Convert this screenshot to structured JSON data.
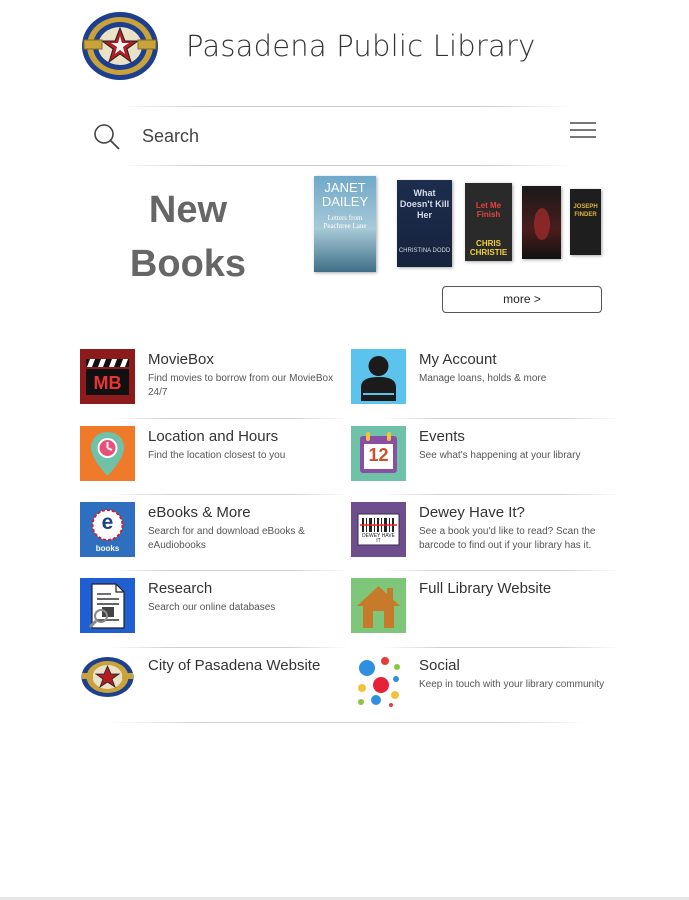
{
  "header": {
    "title": "Pasadena Public Library",
    "seal_icon": "city-seal-icon"
  },
  "search": {
    "placeholder": "Search",
    "value": ""
  },
  "new_books": {
    "heading_line1": "New",
    "heading_line2": "Books",
    "more_label": "more >",
    "covers": [
      {
        "author": "JANET DAILEY",
        "title": "Letters from Peachtree Lane"
      },
      {
        "title": "What Doesn't Kill Her",
        "author": "CHRISTINA DODD"
      },
      {
        "title": "Let Me Finish",
        "author": "CHRIS CHRISTIE"
      },
      {
        "title": ""
      },
      {
        "author": "JOSEPH FINDER"
      }
    ]
  },
  "tiles": [
    {
      "title": "MovieBox",
      "desc": "Find movies to borrow from our MovieBox 24/7",
      "icon": "moviebox-icon",
      "icon_text": "MB"
    },
    {
      "title": "My Account",
      "desc": "Manage loans, holds & more",
      "icon": "account-icon"
    },
    {
      "title": "Location and Hours",
      "desc": "Find the location closest to you",
      "icon": "location-clock-icon"
    },
    {
      "title": "Events",
      "desc": "See what's happening at your library",
      "icon": "calendar-icon",
      "icon_text": "12"
    },
    {
      "title": "eBooks & More",
      "desc": "Search for and download eBooks & eAudiobooks",
      "icon": "ebooks-icon",
      "icon_text": "e",
      "icon_caption": "books"
    },
    {
      "title": "Dewey Have It?",
      "desc": "See a book you'd like to read? Scan the barcode to find out if your library has it.",
      "icon": "barcode-scan-icon",
      "icon_text": "DEWEY HAVE IT"
    },
    {
      "title": "Research",
      "desc": "Search our online databases",
      "icon": "research-document-icon"
    },
    {
      "title": "Full Library Website",
      "desc": "",
      "icon": "home-icon"
    },
    {
      "title": "City of Pasadena Website",
      "desc": "",
      "icon": "city-seal-icon"
    },
    {
      "title": "Social",
      "desc": "Keep in touch with your library community",
      "icon": "social-dots-icon"
    }
  ],
  "colors": {
    "moviebox": "#8e1b1b",
    "account_bg": "#5bc3ec",
    "location_bg": "#ef7a2a",
    "events_bg": "#6fc1a8",
    "ebooks_bg": "#2f6fbf",
    "dewey_bg": "#6e4e8c",
    "research_bg": "#1f5fd1",
    "home_bg": "#7ec77a"
  }
}
